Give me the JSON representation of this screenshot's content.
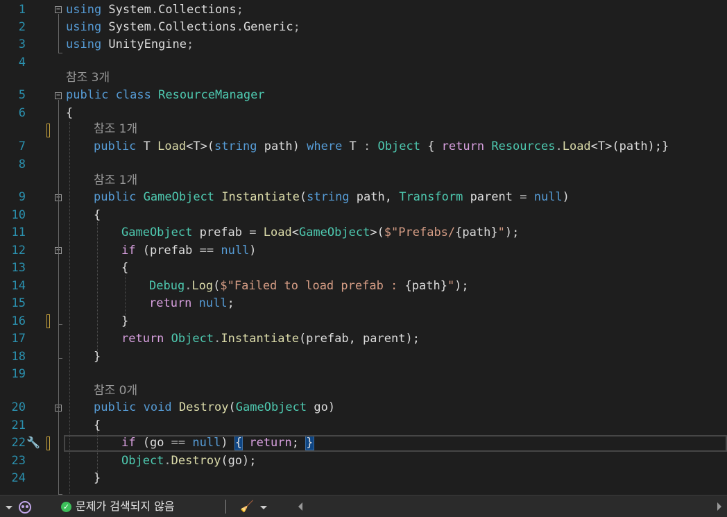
{
  "editor": {
    "line_numbers": [
      "1",
      "2",
      "3",
      "4",
      "5",
      "6",
      "7",
      "8",
      "9",
      "10",
      "11",
      "12",
      "13",
      "14",
      "15",
      "16",
      "17",
      "18",
      "19",
      "20",
      "21",
      "22",
      "23",
      "24"
    ],
    "codelens": [
      "참조 3개",
      "참조 1개",
      "참조 1개",
      "참조 0개"
    ],
    "lines": [
      [
        [
          "kw",
          "using"
        ],
        [
          "pl",
          " System"
        ],
        [
          "op",
          "."
        ],
        [
          "pl",
          "Collections"
        ],
        [
          "op",
          ";"
        ]
      ],
      [
        [
          "kw",
          "using"
        ],
        [
          "pl",
          " System"
        ],
        [
          "op",
          "."
        ],
        [
          "pl",
          "Collections"
        ],
        [
          "op",
          "."
        ],
        [
          "pl",
          "Generic"
        ],
        [
          "op",
          ";"
        ]
      ],
      [
        [
          "kw",
          "using"
        ],
        [
          "pl",
          " UnityEngine"
        ],
        [
          "op",
          ";"
        ]
      ],
      [],
      [
        [
          "kw",
          "public"
        ],
        [
          "pl",
          " "
        ],
        [
          "kw",
          "class"
        ],
        [
          "pl",
          " "
        ],
        [
          "ty",
          "ResourceManager"
        ]
      ],
      [
        [
          "pl",
          "{"
        ]
      ],
      [
        [
          "kw",
          "public"
        ],
        [
          "pl",
          " T "
        ],
        [
          "fn",
          "Load"
        ],
        [
          "pl",
          "<T>("
        ],
        [
          "kw",
          "string"
        ],
        [
          "pl",
          " path) "
        ],
        [
          "kw",
          "where"
        ],
        [
          "pl",
          " T "
        ],
        [
          "op",
          ":"
        ],
        [
          "pl",
          " "
        ],
        [
          "ty",
          "Object"
        ],
        [
          "pl",
          " { "
        ],
        [
          "ctl",
          "return"
        ],
        [
          "pl",
          " "
        ],
        [
          "ty",
          "Resources"
        ],
        [
          "op",
          "."
        ],
        [
          "fn",
          "Load"
        ],
        [
          "pl",
          "<T>(path);}"
        ]
      ],
      [],
      [
        [
          "kw",
          "public"
        ],
        [
          "pl",
          " "
        ],
        [
          "ty",
          "GameObject"
        ],
        [
          "pl",
          " "
        ],
        [
          "fn",
          "Instantiate"
        ],
        [
          "pl",
          "("
        ],
        [
          "kw",
          "string"
        ],
        [
          "pl",
          " path, "
        ],
        [
          "ty",
          "Transform"
        ],
        [
          "pl",
          " parent "
        ],
        [
          "op",
          "="
        ],
        [
          "pl",
          " "
        ],
        [
          "kw",
          "null"
        ],
        [
          "pl",
          ")"
        ]
      ],
      [
        [
          "pl",
          "{"
        ]
      ],
      [
        [
          "ty",
          "GameObject"
        ],
        [
          "pl",
          " prefab "
        ],
        [
          "op",
          "="
        ],
        [
          "pl",
          " "
        ],
        [
          "fn",
          "Load"
        ],
        [
          "pl",
          "<"
        ],
        [
          "ty",
          "GameObject"
        ],
        [
          "pl",
          ">("
        ],
        [
          "str",
          "$\"Prefabs/"
        ],
        [
          "pl",
          "{path}"
        ],
        [
          "str",
          "\""
        ],
        [
          "pl",
          ");"
        ]
      ],
      [
        [
          "ctl",
          "if"
        ],
        [
          "pl",
          " (prefab "
        ],
        [
          "op",
          "=="
        ],
        [
          "pl",
          " "
        ],
        [
          "kw",
          "null"
        ],
        [
          "pl",
          ")"
        ]
      ],
      [
        [
          "pl",
          "{"
        ]
      ],
      [
        [
          "ty",
          "Debug"
        ],
        [
          "op",
          "."
        ],
        [
          "fn",
          "Log"
        ],
        [
          "pl",
          "("
        ],
        [
          "str",
          "$\"Failed to load prefab : "
        ],
        [
          "pl",
          "{path}"
        ],
        [
          "str",
          "\""
        ],
        [
          "pl",
          ");"
        ]
      ],
      [
        [
          "ctl",
          "return"
        ],
        [
          "pl",
          " "
        ],
        [
          "kw",
          "null"
        ],
        [
          "pl",
          ";"
        ]
      ],
      [
        [
          "pl",
          "}"
        ]
      ],
      [
        [
          "ctl",
          "return"
        ],
        [
          "pl",
          " "
        ],
        [
          "ty",
          "Object"
        ],
        [
          "op",
          "."
        ],
        [
          "fn",
          "Instantiate"
        ],
        [
          "pl",
          "(prefab, parent);"
        ]
      ],
      [
        [
          "pl",
          "}"
        ]
      ],
      [],
      [
        [
          "kw",
          "public"
        ],
        [
          "pl",
          " "
        ],
        [
          "kw",
          "void"
        ],
        [
          "pl",
          " "
        ],
        [
          "fn",
          "Destroy"
        ],
        [
          "pl",
          "("
        ],
        [
          "ty",
          "GameObject"
        ],
        [
          "pl",
          " go)"
        ]
      ],
      [
        [
          "pl",
          "{"
        ]
      ],
      [
        [
          "ctl",
          "if"
        ],
        [
          "pl",
          " (go "
        ],
        [
          "op",
          "=="
        ],
        [
          "pl",
          " "
        ],
        [
          "kw",
          "null"
        ],
        [
          "pl",
          ") "
        ],
        [
          "hl",
          "{"
        ],
        [
          "pl",
          " "
        ],
        [
          "ctl",
          "return"
        ],
        [
          "pl",
          "; "
        ],
        [
          "hl",
          "}"
        ]
      ],
      [
        [
          "ty",
          "Object"
        ],
        [
          "op",
          "."
        ],
        [
          "fn",
          "Destroy"
        ],
        [
          "pl",
          "(go);"
        ]
      ],
      [
        [
          "pl",
          "}"
        ]
      ]
    ]
  },
  "status_bar": {
    "issues_text": "문제가 검색되지 않음",
    "dropdown_icon": "chevron-down-icon",
    "copilot_icon": "copilot-icon",
    "ok_icon": "check-circle-icon",
    "cleanup_icon": "broom-icon",
    "ok_color": "#3cbf5a"
  }
}
